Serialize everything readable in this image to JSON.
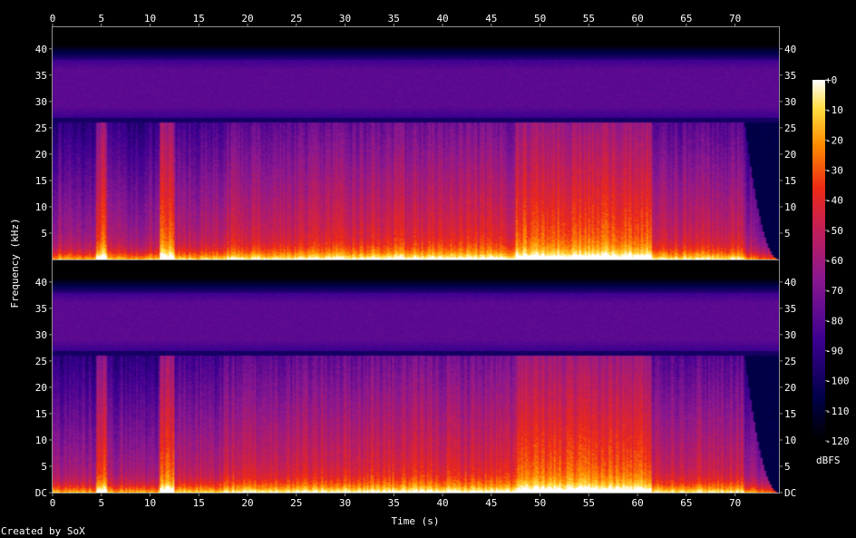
{
  "chart_data": {
    "type": "heatmap",
    "subtype": "spectrogram",
    "channels": 2,
    "xlabel": "Time (s)",
    "ylabel": "Frequency (kHz)",
    "colorbar_label": "dBFS",
    "footer": "Created by SoX",
    "xlim": [
      0,
      74.5
    ],
    "ylim": [
      0,
      44.1
    ],
    "x_ticks": [
      0,
      5,
      10,
      15,
      20,
      25,
      30,
      35,
      40,
      45,
      50,
      55,
      60,
      65,
      70
    ],
    "y_ticks_top": [
      "5",
      "10",
      "15",
      "20",
      "25",
      "30",
      "35",
      "40"
    ],
    "y_ticks_bottom": [
      "DC",
      "5",
      "10",
      "15",
      "20",
      "25",
      "30",
      "35",
      "40"
    ],
    "colorbar_range": [
      -120,
      0
    ],
    "colorbar_ticks": [
      "+0",
      "-10",
      "-20",
      "-30",
      "-40",
      "-50",
      "-60",
      "-70",
      "-80",
      "-90",
      "-100",
      "-110",
      "-120"
    ],
    "lowpass_cutoff_khz": 26,
    "noise_band_khz": [
      27,
      38
    ],
    "sections": [
      {
        "start": 0,
        "end": 4.5,
        "level": 0.55
      },
      {
        "start": 4.5,
        "end": 5.5,
        "level": 0.78
      },
      {
        "start": 5.5,
        "end": 11,
        "level": 0.55
      },
      {
        "start": 11,
        "end": 12.5,
        "level": 0.8
      },
      {
        "start": 12.5,
        "end": 17.5,
        "level": 0.6
      },
      {
        "start": 17.5,
        "end": 25.5,
        "level": 0.66
      },
      {
        "start": 25.5,
        "end": 32.5,
        "level": 0.68
      },
      {
        "start": 32.5,
        "end": 47.5,
        "level": 0.7
      },
      {
        "start": 47.5,
        "end": 61.5,
        "level": 0.8
      },
      {
        "start": 61.5,
        "end": 71,
        "level": 0.65
      }
    ],
    "fade_out": [
      71,
      74.5
    ]
  }
}
